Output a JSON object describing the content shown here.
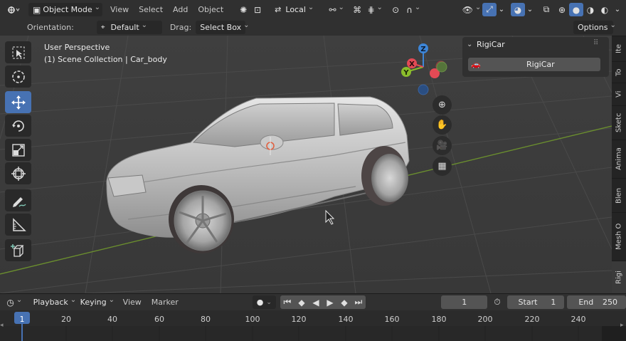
{
  "header": {
    "mode": "Object Mode",
    "menus": [
      "View",
      "Select",
      "Add",
      "Object"
    ],
    "orientation_pivot": "Local"
  },
  "tool_settings": {
    "orientation_label": "Orientation:",
    "orientation_value": "Default",
    "drag_label": "Drag:",
    "drag_value": "Select Box",
    "options": "Options"
  },
  "viewport": {
    "perspective": "User Perspective",
    "collection": "(1) Scene Collection | Car_body",
    "gizmo": {
      "x": "X",
      "y": "Y",
      "z": "Z"
    }
  },
  "panel": {
    "title": "RigiCar",
    "button": "RigiCar"
  },
  "side_tabs": [
    "Ite",
    "To",
    "Vi",
    "Sketc",
    "Anima",
    "Blen",
    "Mesh O",
    "Rigi"
  ],
  "timeline": {
    "menus": [
      "Playback",
      "Keying",
      "View",
      "Marker"
    ],
    "current_frame": "1",
    "start_label": "Start",
    "start_value": "1",
    "end_label": "End",
    "end_value": "250",
    "ruler": [
      "1",
      "20",
      "40",
      "60",
      "80",
      "100",
      "120",
      "140",
      "160",
      "180",
      "200",
      "220",
      "240"
    ]
  },
  "colors": {
    "accent": "#4772b3",
    "x_axis": "#e34a55",
    "y_axis": "#8bbd2c",
    "z_axis": "#3d86d8"
  }
}
